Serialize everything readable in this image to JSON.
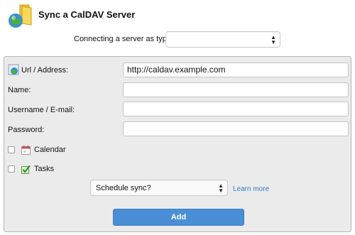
{
  "header": {
    "title": "Sync a CalDAV Server",
    "logo_icon": "globe-folder-icon"
  },
  "type_row": {
    "label": "Connecting a server as type:",
    "selected": ""
  },
  "form": {
    "url": {
      "label": "Url / Address:",
      "value": "http://caldav.example.com"
    },
    "name": {
      "label": "Name:",
      "value": ""
    },
    "username": {
      "label": "Username / E-mail:",
      "value": ""
    },
    "password": {
      "label": "Password:",
      "value": ""
    },
    "calendar": {
      "label": "Calendar",
      "checked": false,
      "icon": "calendar-icon"
    },
    "tasks": {
      "label": "Tasks",
      "checked": false,
      "icon": "tasks-icon"
    }
  },
  "schedule": {
    "selected": "Schedule sync?",
    "learn_more": "Learn more"
  },
  "actions": {
    "add_label": "Add"
  },
  "colors": {
    "accent": "#4a8fd5",
    "link": "#2f7fc8",
    "panel_bg": "#ebebeb"
  }
}
